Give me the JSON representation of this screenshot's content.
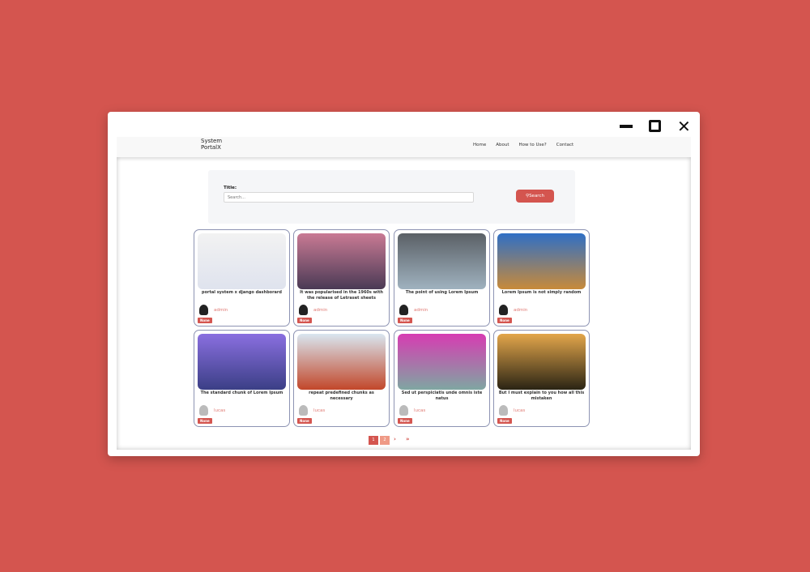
{
  "window": {
    "controls": [
      "minimize",
      "maximize",
      "close"
    ]
  },
  "navbar": {
    "brand_line1": "System",
    "brand_line2": "PortalX",
    "links": [
      "Home",
      "About",
      "How to Use?",
      "Contact"
    ]
  },
  "search": {
    "label": "Title:",
    "placeholder": "Search...",
    "button": "Search"
  },
  "posts": [
    {
      "title": "portal system x django dashborard",
      "author": "admin",
      "badge": "None",
      "colors": [
        "#f2f2f2",
        "#dfe3ee"
      ]
    },
    {
      "title": "It was popularised in the 1960s with the release of Letraset sheets",
      "author": "admin",
      "badge": "None",
      "colors": [
        "#c97a94",
        "#4a3a55"
      ]
    },
    {
      "title": "The point of using Lorem Ipsum",
      "author": "admin",
      "badge": "None",
      "colors": [
        "#5a6066",
        "#9fb2bf"
      ]
    },
    {
      "title": "Lorem Ipsum is not simply random",
      "author": "admin",
      "badge": "None",
      "colors": [
        "#2f6fc5",
        "#c88a3a"
      ]
    },
    {
      "title": "The standard chunk of Lorem Ipsum",
      "author": "lucas",
      "badge": "None",
      "colors": [
        "#8a6fe0",
        "#3b3f86"
      ]
    },
    {
      "title": "repeat predefined chunks as necessary",
      "author": "lucas",
      "badge": "None",
      "colors": [
        "#d9e6f0",
        "#c2472a"
      ]
    },
    {
      "title": "Sed ut perspiciatis unde omnis iste natus",
      "author": "lucas",
      "badge": "None",
      "colors": [
        "#d73cb2",
        "#7fa6a2"
      ]
    },
    {
      "title": "But I must explain to you how all this mistaken",
      "author": "lucas",
      "badge": "None",
      "colors": [
        "#e3a64b",
        "#2a2414"
      ]
    }
  ],
  "pagination": {
    "pages": [
      "1",
      "2"
    ],
    "current": "1",
    "next": "›",
    "last": "»"
  }
}
